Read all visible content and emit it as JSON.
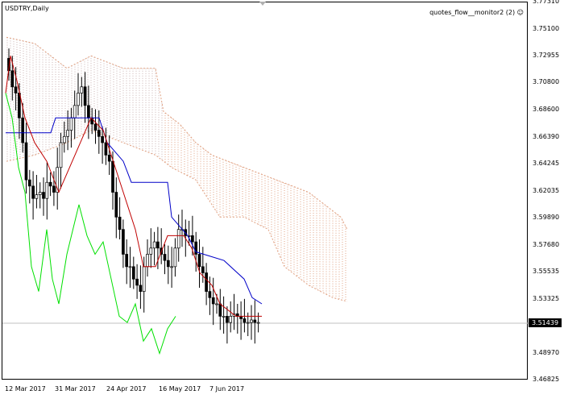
{
  "chart": {
    "symbol_title": "USDTRY,Daily",
    "indicator_title": "quotes_flow__monitor2 (2)",
    "indicator_icon": "smiley-icon",
    "current_price": "3.51439",
    "colors": {
      "background": "#ffffff",
      "bull_candle": "#000000",
      "bear_candle": "#000000",
      "tenkan": "#c00000",
      "kijun": "#0000c8",
      "chikou": "#00e000",
      "cloud_up": "#e0a080",
      "cloud_down": "#c8b0b0",
      "current_price_line": "#c0c0c0"
    }
  },
  "axes": {
    "price_ticks": [
      "3.77310",
      "3.75100",
      "3.72955",
      "3.70800",
      "3.68600",
      "3.66390",
      "3.64245",
      "3.62035",
      "3.59890",
      "3.57680",
      "3.55535",
      "3.53325",
      "3.51439",
      "3.48970",
      "3.46825"
    ],
    "date_ticks": [
      "12 Mar 2017",
      "31 Mar 2017",
      "24 Apr 2017",
      "16 May 2017",
      "7 Jun 2017"
    ]
  },
  "chart_data": {
    "type": "line",
    "title": "USDTRY,Daily",
    "ylim": [
      3.46825,
      3.7731
    ],
    "x": [
      "12 Mar 2017",
      "31 Mar 2017",
      "24 Apr 2017",
      "16 May 2017",
      "7 Jun 2017"
    ],
    "series": [
      {
        "values": [
          3.718,
          3.705,
          3.7,
          3.68,
          3.66,
          3.63,
          3.625,
          3.615,
          3.618,
          3.62,
          3.615,
          3.628,
          3.625,
          3.62,
          3.64,
          3.66,
          3.665,
          3.67,
          3.68,
          3.69,
          3.7,
          3.705,
          3.69,
          3.68,
          3.675,
          3.67,
          3.665,
          3.66,
          3.65,
          3.645,
          3.62,
          3.6,
          3.59,
          3.57,
          3.56,
          3.56,
          3.55,
          3.545,
          3.54,
          3.56,
          3.57,
          3.575,
          3.58,
          3.575,
          3.57,
          3.565,
          3.56,
          3.56,
          3.575,
          3.59,
          3.59,
          3.585,
          3.585,
          3.58,
          3.57,
          3.56,
          3.555,
          3.54,
          3.535,
          3.53,
          3.53,
          3.52,
          3.52,
          3.515,
          3.52,
          3.522,
          3.52,
          3.518,
          3.515,
          3.515,
          3.517,
          3.515,
          3.515
        ]
      }
    ]
  }
}
